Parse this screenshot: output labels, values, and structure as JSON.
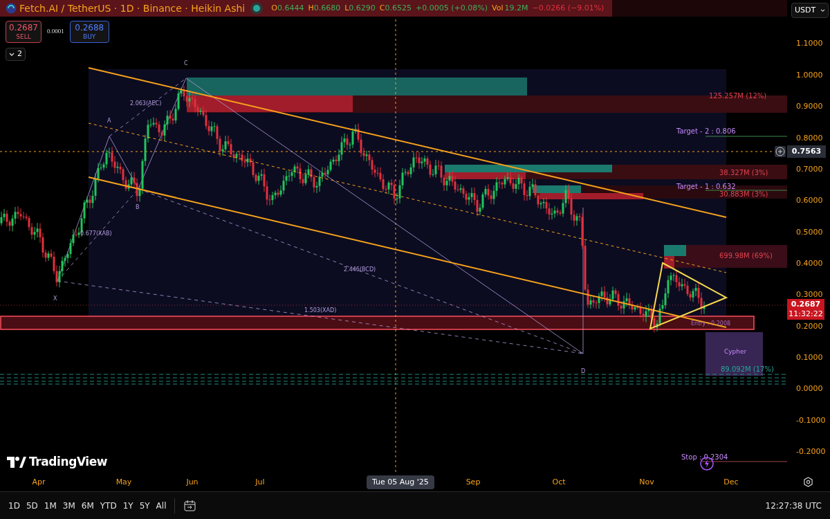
{
  "legend": {
    "title": "Fetch.AI / TetherUS · 1D · Binance · Heikin Ashi",
    "market_open": true,
    "ohlc": [
      {
        "key": "O",
        "value": "0.6444"
      },
      {
        "key": "H",
        "value": "0.6680"
      },
      {
        "key": "L",
        "value": "0.6290"
      },
      {
        "key": "C",
        "value": "0.6525"
      }
    ],
    "change": "+0.0005 (+0.08%)",
    "volume_label": "Vol",
    "volume": "19.2M",
    "volume_change": "−0.0266 (−9.01%)"
  },
  "trade": {
    "sell_price": "0.2687",
    "sell_label": "SELL",
    "spread": "0.0001",
    "buy_price": "0.2688",
    "buy_label": "BUY"
  },
  "indicators_toggle": {
    "count": "2"
  },
  "currency": "USDT",
  "pattern_labels": [
    {
      "text": "C"
    },
    {
      "text": "2.063(AEC)"
    },
    {
      "text": "A"
    },
    {
      "text": "B"
    },
    {
      "text": "0.677(XAB)"
    },
    {
      "text": "2.446(BCD)"
    },
    {
      "text": "X"
    },
    {
      "text": "1.503(XAD)"
    },
    {
      "text": "D"
    },
    {
      "text": "Cypher"
    }
  ],
  "levels": [
    {
      "text": "125.257M (12%)",
      "kind": "volume"
    },
    {
      "text": "Target - 2 : 0.806",
      "kind": "target"
    },
    {
      "text": "38.327M (3%)",
      "kind": "volume"
    },
    {
      "text": "Target - 1 : 0.632",
      "kind": "target"
    },
    {
      "text": "30.883M (3%)",
      "kind": "volume"
    },
    {
      "text": "699.98M (69%)",
      "kind": "volume"
    },
    {
      "text": "Entry : 0.2008",
      "kind": "entry"
    },
    {
      "text": "89.092M (17%)",
      "kind": "cluster"
    },
    {
      "text": "Stop : 0.2304",
      "kind": "stop"
    }
  ],
  "brand": "TradingView",
  "price_axis": {
    "ticks": [
      "1.1000",
      "1.0000",
      "0.9000",
      "0.8000",
      "0.7000",
      "0.6000",
      "0.5000",
      "0.4000",
      "0.3000",
      "0.2000",
      "0.1000",
      "0.0000",
      "-0.1000",
      "-0.2000"
    ],
    "crosshair_price": "0.7563",
    "last_price": "0.2687",
    "countdown": "11:32:22"
  },
  "time_axis": {
    "ticks": [
      "Apr",
      "May",
      "Jun",
      "Jul",
      "Sep",
      "Oct",
      "Nov",
      "Dec"
    ],
    "crosshair_date": "Tue 05 Aug '25"
  },
  "ranges": [
    "1D",
    "5D",
    "1M",
    "3M",
    "6M",
    "YTD",
    "1Y",
    "5Y",
    "All"
  ],
  "clock": "12:27:38 UTC"
}
